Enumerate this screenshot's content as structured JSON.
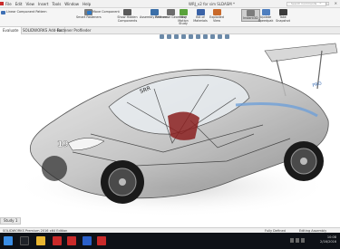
{
  "titlebar": {
    "menu": [
      "File",
      "Edit",
      "View",
      "Insert",
      "Tools",
      "Window",
      "Help"
    ],
    "document_title": "WRJ_v2 for sim SLDASM *",
    "search_placeholder": "Search Commands",
    "window_buttons": "–  □  ✕"
  },
  "ribbon": {
    "buttons": [
      {
        "label": "Linear Component Pattern",
        "color": "#3d6fb4"
      },
      {
        "label": "Smart Fasteners",
        "color": "#7a7a7a"
      },
      {
        "label": "Move Component",
        "color": "#2d79c7"
      },
      {
        "label": "Show Hidden Components",
        "color": "#5a5a5a"
      },
      {
        "label": "Assembly Features",
        "color": "#3b6fa8"
      },
      {
        "label": "Reference Geometry",
        "color": "#6c6c6c"
      },
      {
        "label": "New Motion Study",
        "color": "#5aa33b"
      },
      {
        "label": "Bill of Materials",
        "color": "#3a62a6"
      },
      {
        "label": "Exploded View",
        "color": "#c96a2b"
      },
      {
        "label": "Instant3D",
        "color": "#7d7d7d"
      },
      {
        "label": "Update Speedpak",
        "color": "#4f7fbf"
      },
      {
        "label": "Take Snapshot",
        "color": "#3b3b3b"
      }
    ]
  },
  "tabs": [
    "Evaluate",
    "SOLIDWORKS Add-Ins",
    "Fastener Profileder"
  ],
  "viewport": {
    "decal_texts": [
      "SRR",
      "PRO"
    ],
    "car_number": "19"
  },
  "bottom_tab": "Study 1",
  "statusbar": {
    "left": "SOLIDWORKS Premium 2016 x64 Edition",
    "fully_defined": "Fully Defined",
    "editing": "Editing Assembly"
  },
  "taskbar": {
    "time": "10:08",
    "date": "2/16/2016",
    "apps": [
      {
        "name": "windows-start",
        "color": "#3a8ee6"
      },
      {
        "name": "search",
        "color": "#1e2229"
      },
      {
        "name": "file-explorer",
        "color": "#e8b531"
      },
      {
        "name": "solidworks-1",
        "color": "#c92a2a"
      },
      {
        "name": "solidworks-2",
        "color": "#c92a2a"
      },
      {
        "name": "app-3",
        "color": "#2a5fc9"
      },
      {
        "name": "app-4",
        "color": "#c92a2a"
      }
    ]
  }
}
